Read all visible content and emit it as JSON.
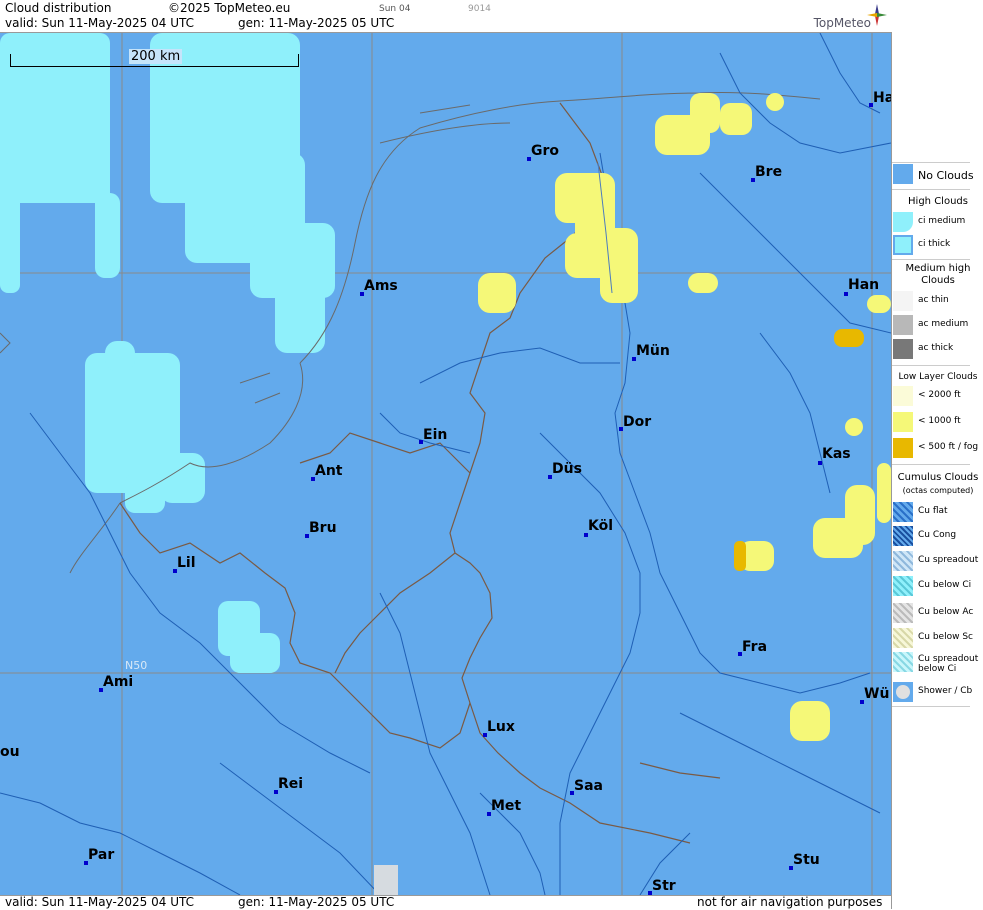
{
  "header": {
    "title": "Cloud distribution",
    "copyright": "©2025 TopMeteo.eu",
    "code_day": "Sun 04",
    "code_num": "9014",
    "valid": "valid:  Sun  11-May-2025  04 UTC",
    "gen": "gen: 11-May-2025 05 UTC",
    "logo": "TopMeteo"
  },
  "footer": {
    "valid": "valid:  Sun  11-May-2025  04 UTC",
    "gen": "gen: 11-May-2025 05 UTC",
    "disclaimer": "not for air navigation purposes"
  },
  "map": {
    "scale_label": "200 km",
    "lat_label": "N50",
    "cities": [
      {
        "name": "Gro"
      },
      {
        "name": "Bre"
      },
      {
        "name": "Ha"
      },
      {
        "name": "Ams"
      },
      {
        "name": "Han"
      },
      {
        "name": "Mün"
      },
      {
        "name": "Dor"
      },
      {
        "name": "Ein"
      },
      {
        "name": "Düs"
      },
      {
        "name": "Kas"
      },
      {
        "name": "Ant"
      },
      {
        "name": "Bru"
      },
      {
        "name": "Köl"
      },
      {
        "name": "Lil"
      },
      {
        "name": "Fra"
      },
      {
        "name": "Ami"
      },
      {
        "name": "Wü"
      },
      {
        "name": "Lux"
      },
      {
        "name": "ou"
      },
      {
        "name": "Rei"
      },
      {
        "name": "Saa"
      },
      {
        "name": "Met"
      },
      {
        "name": "Par"
      },
      {
        "name": "Stu"
      },
      {
        "name": "Str"
      }
    ],
    "colors": {
      "no_clouds": "#63aaec",
      "ci_medium": "#8ff0fb",
      "lowcloud_lt1000": "#f5f878",
      "lowcloud_lt500": "#e8b800",
      "border": "#7a5a44",
      "river": "#1f5fb4"
    }
  },
  "legend": {
    "no_clouds": "No Clouds",
    "high_clouds": "High Clouds",
    "ci_medium": "ci medium",
    "ci_thick": "ci thick",
    "medium_high": "Medium high Clouds",
    "ac_thin": "ac thin",
    "ac_medium": "ac medium",
    "ac_thick": "ac thick",
    "low_layer": "Low Layer Clouds",
    "lt2000": "< 2000 ft",
    "lt1000": "< 1000 ft",
    "lt500": "< 500 ft / fog",
    "cumulus": "Cumulus Clouds",
    "octas": "(octas computed)",
    "cu_flat": "Cu flat",
    "cu_cong": "Cu Cong",
    "cu_spreadout": "Cu spreadout",
    "cu_below_ci": "Cu below Ci",
    "cu_below_ac": "Cu below Ac",
    "cu_below_sc": "Cu below Sc",
    "cu_spread_below_ci": "Cu spreadout below Ci",
    "shower": "Shower / Cb"
  }
}
